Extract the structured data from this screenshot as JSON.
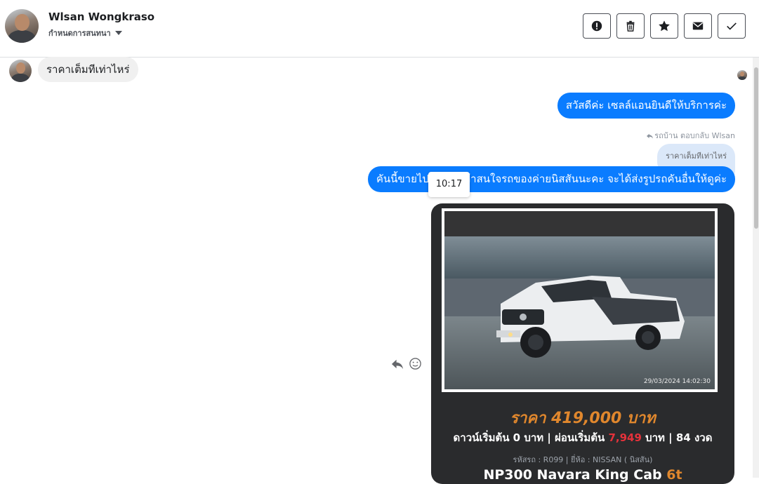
{
  "header": {
    "contact_name": "Wlsan Wongkraso",
    "subtitle": "กำหนดการสนทนา"
  },
  "toolbar": {
    "buttons": [
      {
        "icon": "alert-icon"
      },
      {
        "icon": "trash-icon"
      },
      {
        "icon": "star-icon"
      },
      {
        "icon": "envelope-icon"
      },
      {
        "icon": "check-icon"
      }
    ]
  },
  "thread": {
    "incoming_message": "ราคาเต็มทีเท่าไหร่",
    "outgoing_greeting": "สวัสดีค่ะ เซลล์แอนยินดีให้บริการค่ะ",
    "reply_meta": "รถบ้าน ตอบกลับ Wlsan",
    "quoted_text": "ราคาเต็มทีเท่าไหร่",
    "outgoing_reply": "คันนี้ขายไปแล้วค่ะ ถ้าสนใจรถของค่ายนิสสันนะคะ จะได้ส่งรูปรถคันอื่นให้ดูค่ะ",
    "tooltip_time": "10:17"
  },
  "listing": {
    "photo_timestamp": "29/03/2024 14:02:30",
    "price": "ราคา 419,000 บาท",
    "terms_prefix": "ดาวน์เริ่มต้น 0 บาท | ผ่อนเริ่มต้น ",
    "installment": "7,949",
    "terms_suffix": " บาท | 84 งวด",
    "specs": "รหัสรถ : R099 | ยี่ห้อ : NISSAN ( นิสสัน)",
    "model": "NP300 Navara King Cab",
    "model_suffix": "6t"
  },
  "colors": {
    "outgoing_bubble": "#0a7cff",
    "incoming_bubble": "#f0f0f0",
    "card_bg": "#2a2b2d",
    "price_orange": "#e0872d",
    "installment_red": "#e5323b"
  }
}
